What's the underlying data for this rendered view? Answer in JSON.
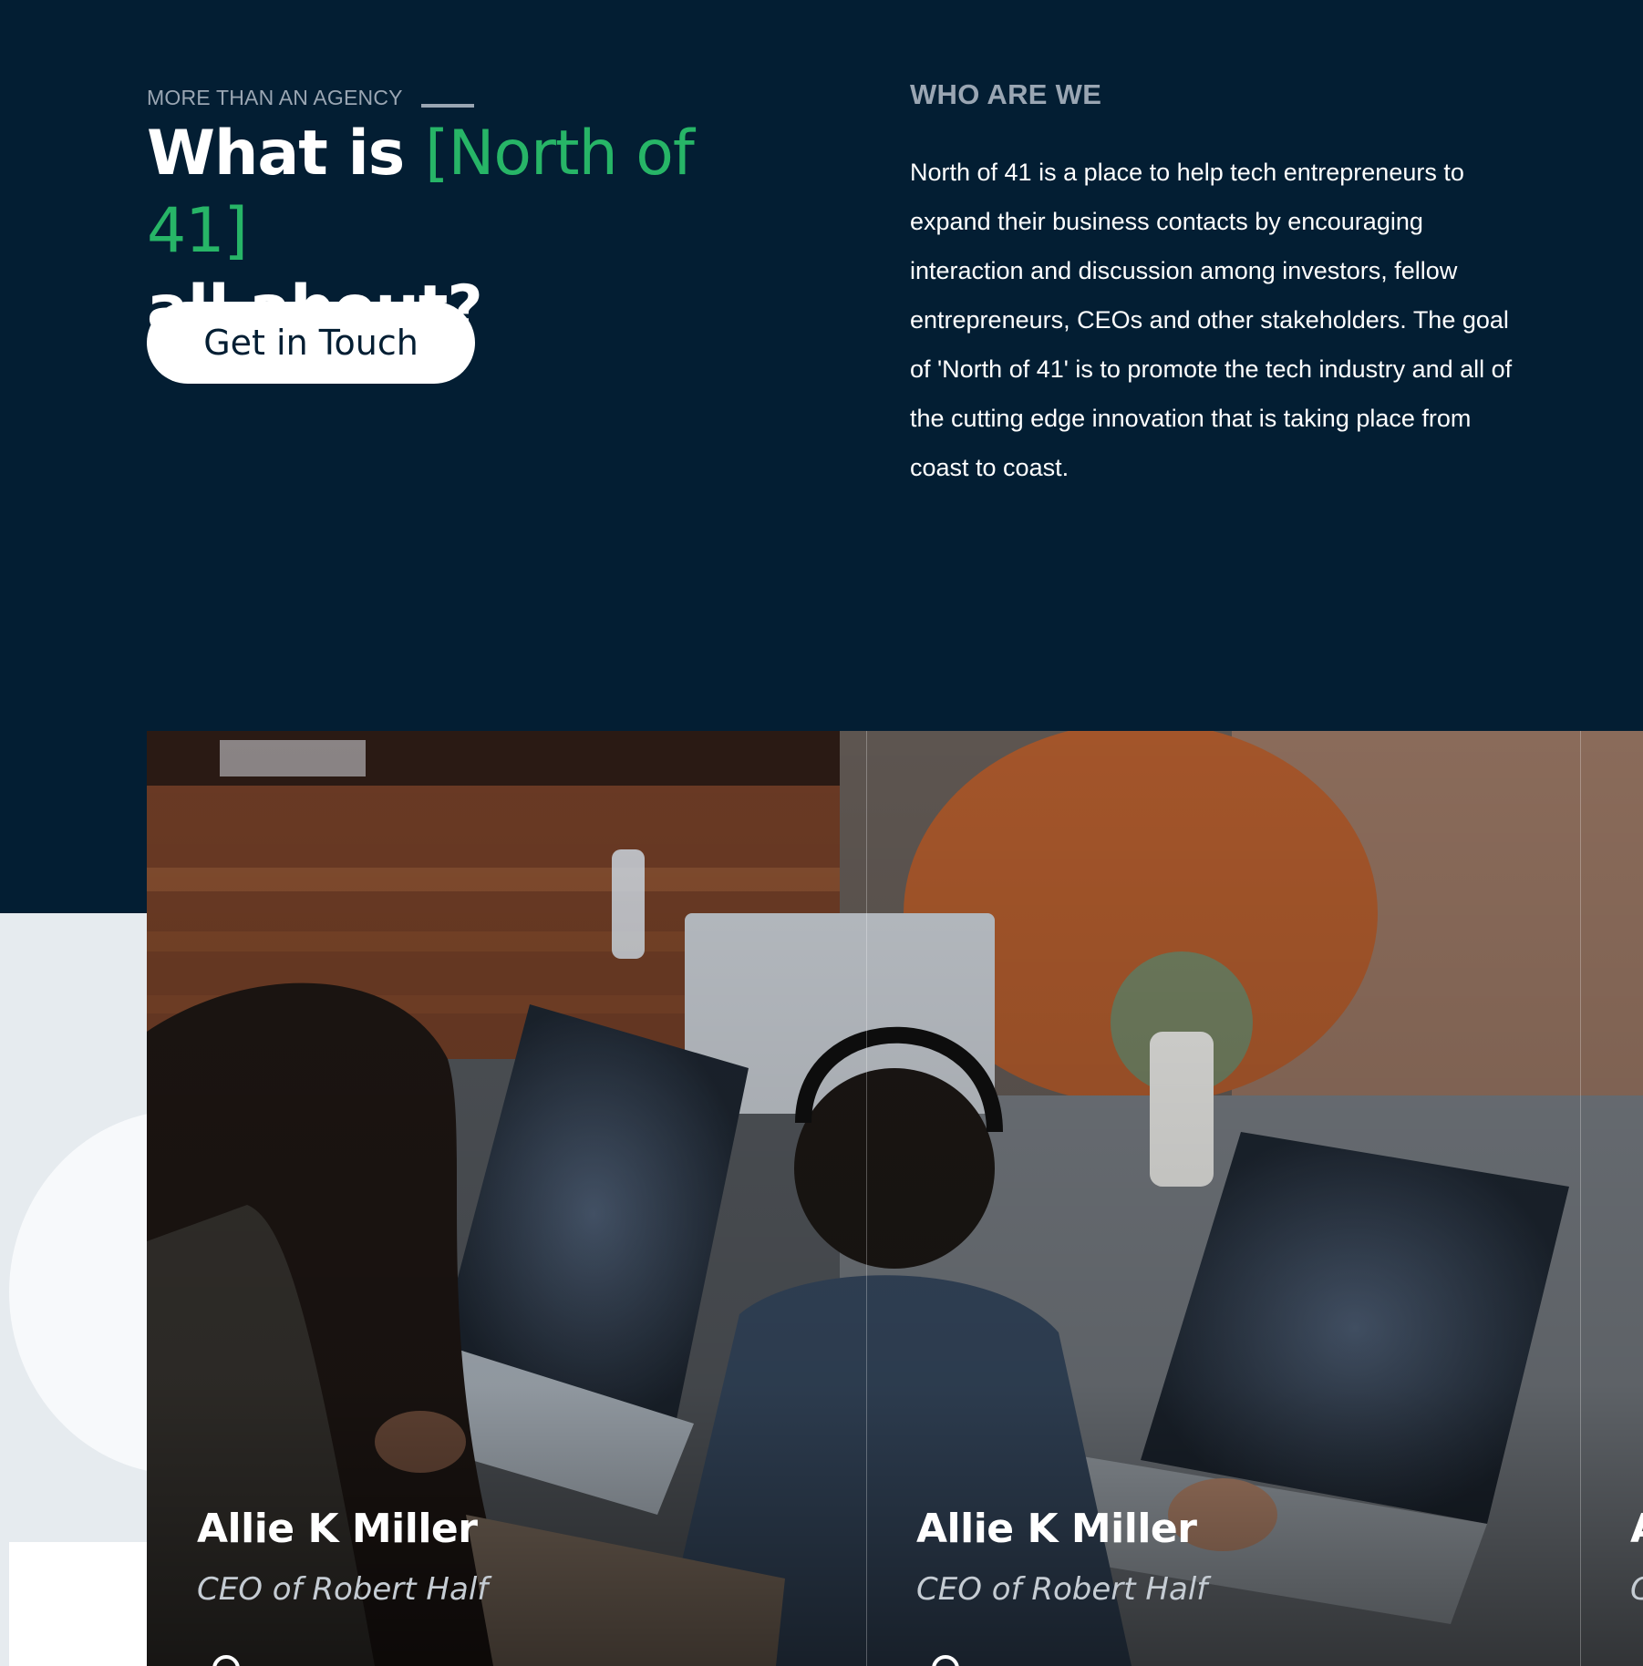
{
  "hero": {
    "eyebrow": "MORE THAN AN AGENCY",
    "headline_part1": "What is ",
    "headline_accent": "[North of 41]",
    "headline_part2": "all about?",
    "cta_label": "Get in Touch"
  },
  "about": {
    "title": "WHO ARE WE",
    "body": "North of 41 is a place to help tech entrepreneurs to expand their business contacts by encouraging interaction and discussion among investors, fellow entrepreneurs, CEOs and other stakeholders. The goal of 'North of 41' is to promote the tech industry and all of the cutting edge innovation that is taking place from coast to coast."
  },
  "team": {
    "cards": [
      {
        "name": "Allie K Miller",
        "role": "CEO of Robert Half"
      },
      {
        "name": "Allie K Miller",
        "role": "CEO of Robert Half"
      },
      {
        "name": "A",
        "role": "C"
      }
    ]
  },
  "colors": {
    "navy": "#031e33",
    "accent_green": "#27b567",
    "muted": "#9aa6b3",
    "white": "#ffffff"
  }
}
